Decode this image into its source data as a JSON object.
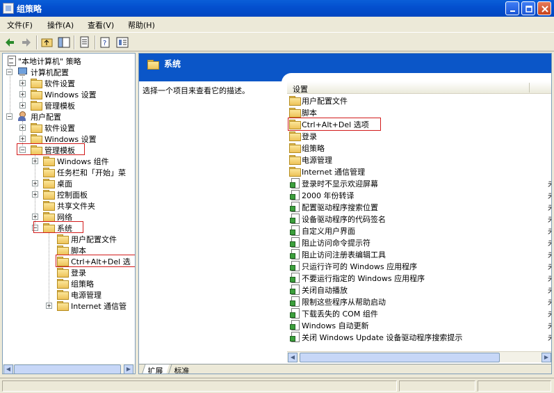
{
  "window": {
    "title": "组策略"
  },
  "menu": [
    "文件(F)",
    "操作(A)",
    "查看(V)",
    "帮助(H)"
  ],
  "tree": {
    "root": "\"本地计算机\" 策略",
    "computer_config": "计算机配置",
    "software_settings_1": "软件设置",
    "windows_settings_1": "Windows 设置",
    "admin_templates_1": "管理模板",
    "user_config": "用户配置",
    "software_settings_2": "软件设置",
    "windows_settings_2": "Windows 设置",
    "admin_templates_2": "管理模板",
    "windows_components": "Windows 组件",
    "taskbar": "任务栏和「开始」菜",
    "desktop": "桌面",
    "control_panel": "控制面板",
    "shared_folders": "共享文件夹",
    "network": "网络",
    "system": "系统",
    "user_profiles": "用户配置文件",
    "scripts": "脚本",
    "ctrl_alt_del": "Ctrl+Alt+Del 选",
    "logon": "登录",
    "group_policy": "组策略",
    "power_management": "电源管理",
    "internet_comm": "Internet 通信管"
  },
  "detail": {
    "header_title": "系统",
    "description": "选择一个项目来查看它的描述。",
    "column_setting": "设置",
    "folders": [
      "用户配置文件",
      "脚本",
      "Ctrl+Alt+Del 选项",
      "登录",
      "组策略",
      "电源管理",
      "Internet 通信管理"
    ],
    "settings": [
      "登录时不显示欢迎屏幕",
      "2000 年份转译",
      "配置驱动程序搜索位置",
      "设备驱动程序的代码签名",
      "自定义用户界面",
      "阻止访问命令提示符",
      "阻止访问注册表编辑工具",
      "只运行许可的 Windows 应用程序",
      "不要运行指定的 Windows 应用程序",
      "关闭自动播放",
      "限制这些程序从帮助启动",
      "下载丢失的 COM 组件",
      "Windows 自动更新",
      "关闭 Windows Update 设备驱动程序搜索提示"
    ],
    "state_glyph": "未"
  },
  "tabs": [
    "扩展",
    "标准"
  ]
}
